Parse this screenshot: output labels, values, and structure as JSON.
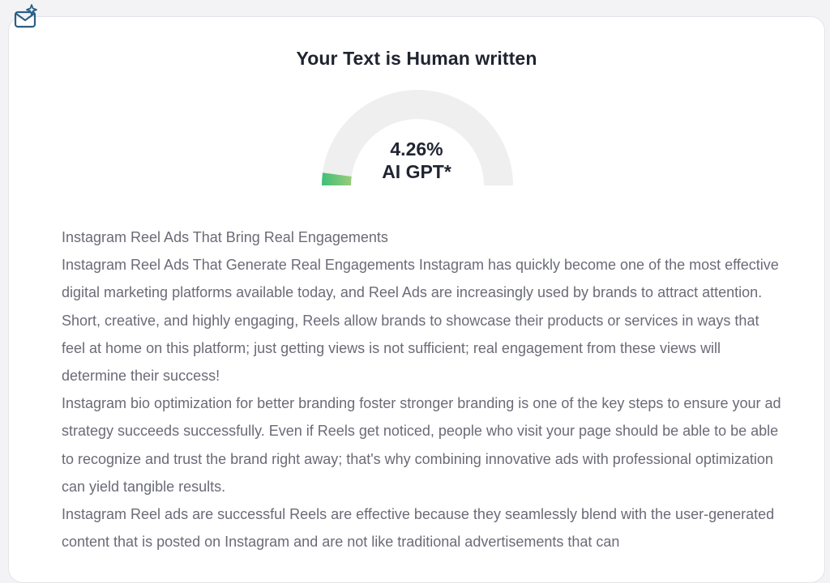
{
  "icons": {
    "mail": "mail-sparkle-icon"
  },
  "result": {
    "title": "Your Text is Human written",
    "percentage": "4.26%",
    "percentage_value": 4.26,
    "label": "AI GPT*"
  },
  "colors": {
    "gauge_track": "#efefef",
    "gauge_fill_start": "#3fbf78",
    "gauge_fill_end": "#9acb7a",
    "text": "#6b6b78",
    "heading": "#1f2430"
  },
  "content": {
    "paragraphs": [
      "Instagram Reel Ads That Bring Real Engagements",
      "Instagram Reel Ads That Generate Real Engagements Instagram has quickly become one of the most effective digital marketing platforms available today, and Reel Ads are increasingly used by brands to attract attention. Short, creative, and highly engaging, Reels allow brands to showcase their products or services in ways that feel at home on this platform; just getting views is not sufficient; real engagement from these views will determine their success!",
      "Instagram bio optimization for better branding foster stronger branding is one of the key steps to ensure your ad strategy succeeds successfully. Even if Reels get noticed, people who visit your page should be able to be able to recognize and trust the brand right away; that's why combining innovative ads with professional optimization can yield tangible results.",
      "Instagram Reel ads are successful Reels are effective because they seamlessly blend with the user-generated content that is posted on Instagram and are not like traditional advertisements that can"
    ]
  }
}
